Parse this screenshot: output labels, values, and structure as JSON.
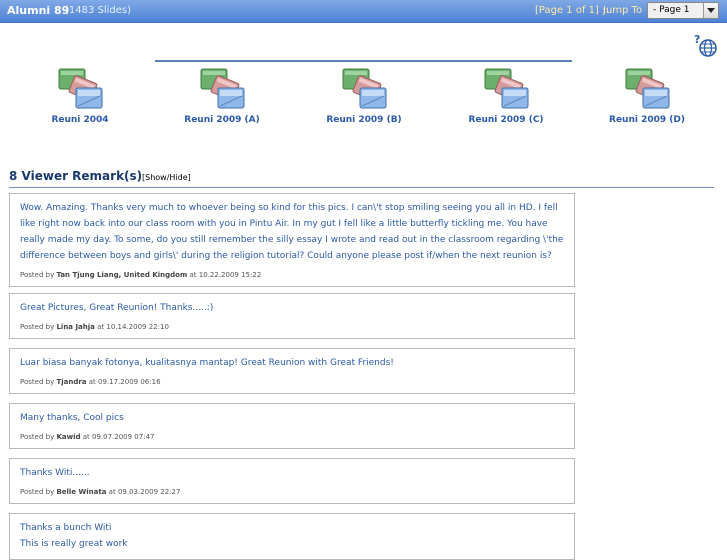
{
  "header": {
    "title": "Alumni 89",
    "slide_count": "(1483 Slides)",
    "page_info": "[Page 1 of 1] ::",
    "jump_label": "Jump To",
    "page_select": "- Page 1"
  },
  "albums": [
    {
      "label": "Reuni 2004"
    },
    {
      "label": "Reuni 2009 (A)"
    },
    {
      "label": "Reuni 2009 (B)"
    },
    {
      "label": "Reuni 2009 (C)"
    },
    {
      "label": "Reuni 2009 (D)"
    }
  ],
  "remarks": {
    "heading": "8 Viewer Remark(s)",
    "toggle": "[Show/Hide]",
    "posted_by": "Posted by",
    "at": "at",
    "items": [
      {
        "text": "Wow. Amazing. Thanks very much to whoever being so kind for this pics. I can\\'t stop smiling seeing you all in HD. I fell like right now back into our class room with you in Pintu Air. In my gut I fell like a little butterfly tickling me. You have really made my day. To some, do you still remember the silly essay I wrote and read out in the classroom regarding \\'the difference between boys and girls\\' during the religion tutorial? Could anyone please post if/when the next reunion is?",
        "author": "Tan Tjung Liang, United Kingdom",
        "date": "10.22.2009 15:22"
      },
      {
        "text": "Great Pictures, Great Reunion! Thanks.....:)",
        "author": "Lina Jahja",
        "date": "10.14.2009 22:10"
      },
      {
        "text": "Luar biasa banyak fotonya, kualitasnya mantap! Great Reunion with Great Friends!",
        "author": "Tjandra",
        "date": "09.17.2009 06:16"
      },
      {
        "text": "Many thanks, Cool pics",
        "author": "Kawid",
        "date": "09.07.2009 07:47"
      },
      {
        "text": "Thanks Witi......",
        "author": "Belle Winata",
        "date": "09.03.2009 22:27"
      },
      {
        "text": "Thanks a bunch Witi\nThis is really great work",
        "author": "",
        "date": ""
      }
    ]
  }
}
